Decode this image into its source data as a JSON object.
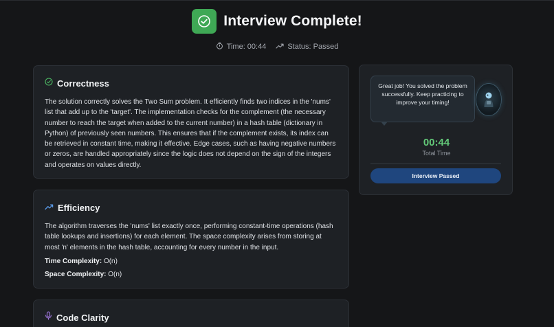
{
  "header": {
    "title": "Interview Complete!",
    "time_text": "Time: 00:44",
    "status_text": "Status: Passed"
  },
  "correctness": {
    "title": "Correctness",
    "body": "The solution correctly solves the Two Sum problem. It efficiently finds two indices in the 'nums' list that add up to the 'target'. The implementation checks for the complement (the necessary number to reach the target when added to the current number) in a hash table (dictionary in Python) of previously seen numbers. This ensures that if the complement exists, its index can be retrieved in constant time, making it effective. Edge cases, such as having negative numbers or zeros, are handled appropriately since the logic does not depend on the sign of the integers and operates on values directly."
  },
  "efficiency": {
    "title": "Efficiency",
    "body": "The algorithm traverses the 'nums' list exactly once, performing constant-time operations (hash table lookups and insertions) for each element. The space complexity arises from storing at most 'n' elements in the hash table, accounting for every number in the input.",
    "time_label": "Time Complexity:",
    "time_value": "O(n)",
    "space_label": "Space Complexity:",
    "space_value": "O(n)"
  },
  "code_clarity": {
    "title": "Code Clarity"
  },
  "sidebar": {
    "message": "Great job! You solved the problem successfully. Keep practicing to improve your timing!",
    "timer_value": "00:44",
    "timer_label": "Total Time",
    "button_label": "Interview Passed"
  },
  "colors": {
    "background": "#151618",
    "card": "#1e2125",
    "success": "#3fa855",
    "timer": "#63c979",
    "button": "#1f467e"
  },
  "icons": [
    "check-circle-icon",
    "stopwatch-icon",
    "trending-up-icon",
    "check-circle-outline-icon",
    "trend-up-icon",
    "microphone-icon",
    "robot-avatar-icon"
  ]
}
